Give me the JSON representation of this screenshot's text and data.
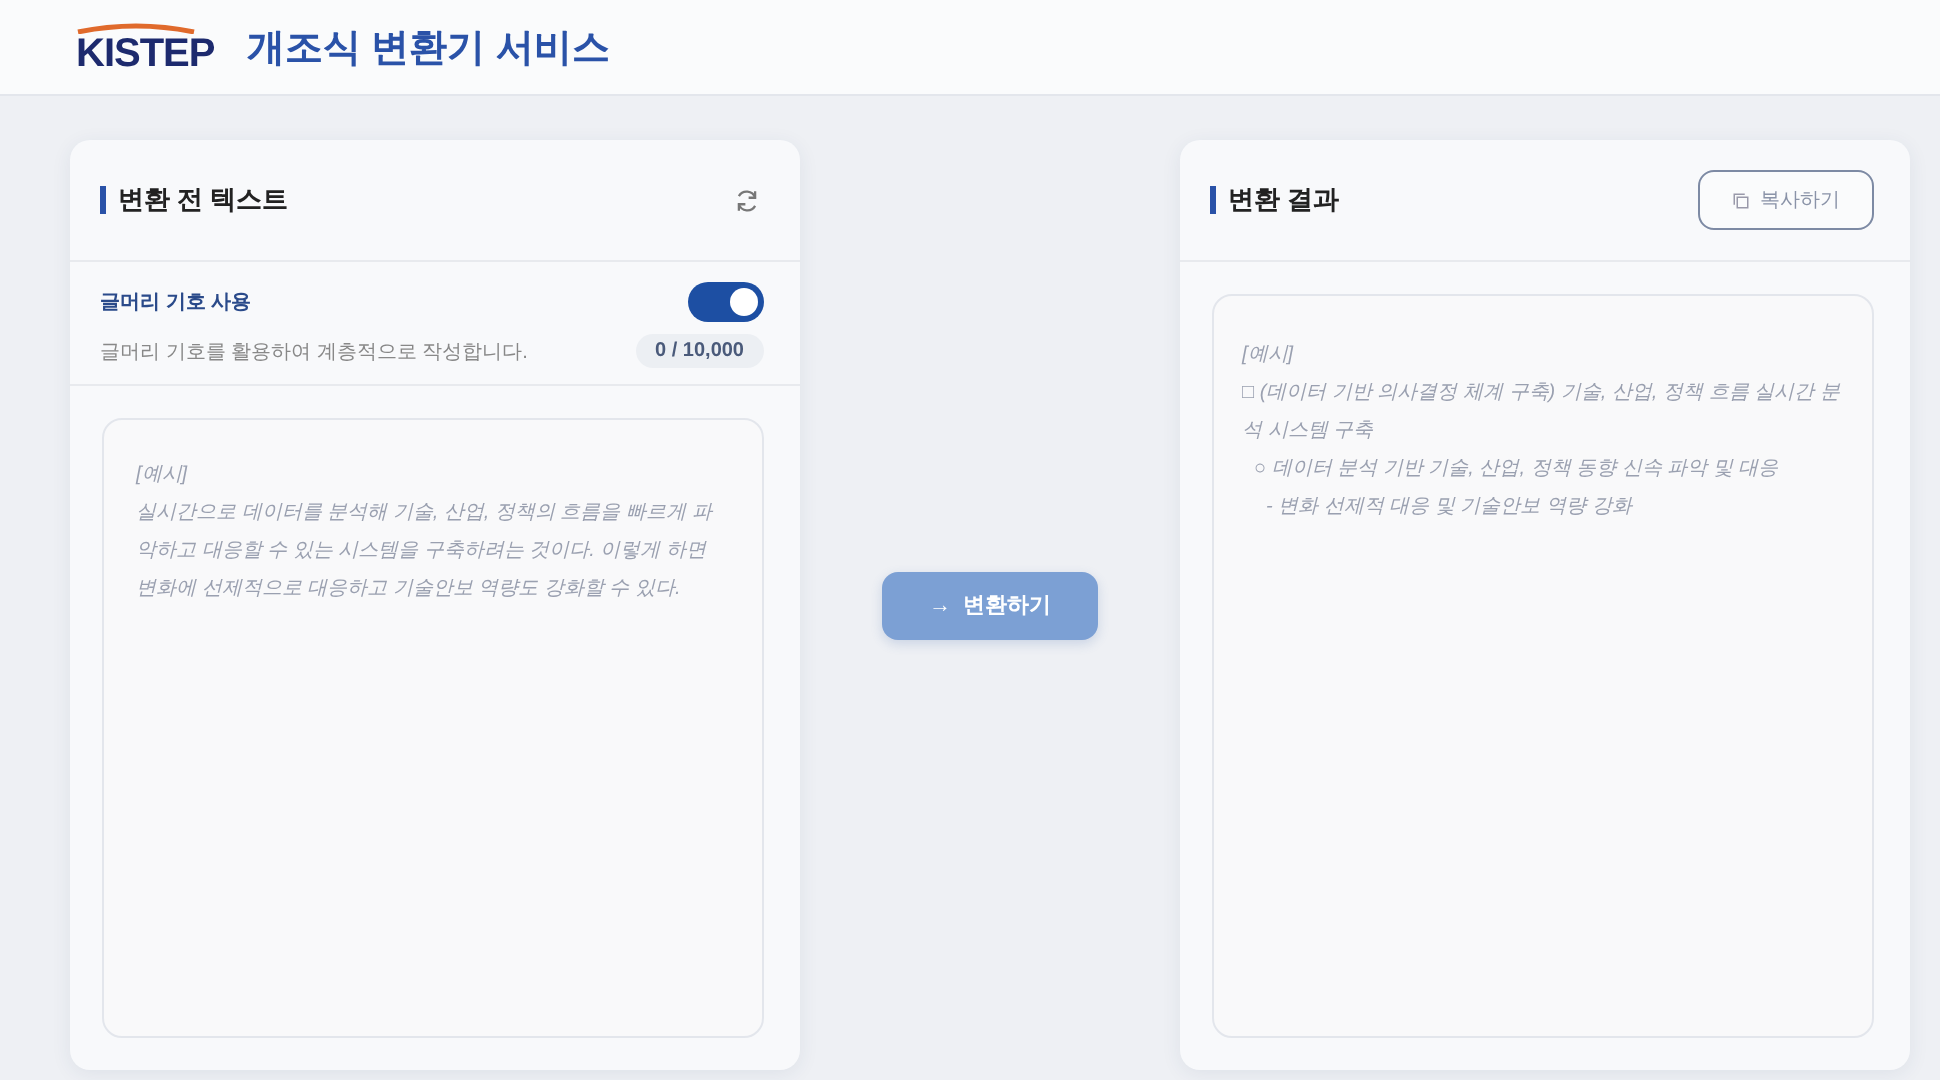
{
  "header": {
    "logo": "KISTEP",
    "title": "개조식 변환기 서비스"
  },
  "input_panel": {
    "title": "변환 전 텍스트",
    "option": {
      "label": "글머리 기호 사용",
      "description": "글머리 기호를 활용하여 계층적으로 작성합니다.",
      "on": true
    },
    "counter": "0 / 10,000",
    "placeholder": "[예시]\n실시간으로 데이터를 분석해 기술, 산업, 정책의 흐름을 빠르게 파악하고 대응할 수 있는 시스템을 구축하려는 것이다. 이렇게 하면 변화에 선제적으로 대응하고 기술안보 역량도 강화할 수 있다."
  },
  "convert_button": {
    "arrow": "→",
    "label": "변환하기"
  },
  "result_panel": {
    "title": "변환 결과",
    "copy_button": "복사하기",
    "lines": [
      {
        "text": "[예시]"
      },
      {
        "text": "□ (데이터 기반 의사결정 체계 구축) 기술, 산업, 정책 흐름 실시간 분석 시스템 구축",
        "children": [
          {
            "text": "○ 데이터 분석 기반 기술, 산업, 정책 동향 신속 파악 및 대응",
            "children": [
              {
                "text": "- 변화 선제적 대응 및 기술안보 역량 강화"
              }
            ]
          }
        ]
      }
    ]
  }
}
